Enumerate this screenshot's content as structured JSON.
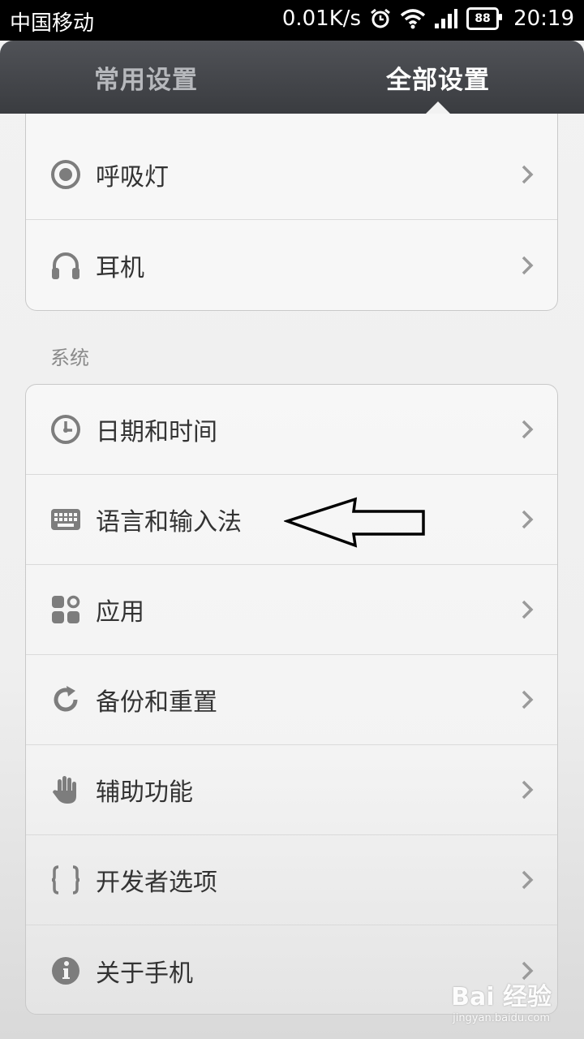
{
  "status_bar": {
    "carrier": "中国移动",
    "speed": "0.01K/s",
    "battery": "88",
    "time": "20:19"
  },
  "tabs": [
    {
      "label": "常用设置",
      "active": false
    },
    {
      "label": "全部设置",
      "active": true
    }
  ],
  "top_group": {
    "items": [
      {
        "label": "呼吸灯",
        "icon": "breathing-light-icon"
      },
      {
        "label": "耳机",
        "icon": "headphones-icon"
      }
    ]
  },
  "system_section": {
    "title": "系统",
    "items": [
      {
        "label": "日期和时间",
        "icon": "clock-icon"
      },
      {
        "label": "语言和输入法",
        "icon": "keyboard-icon"
      },
      {
        "label": "应用",
        "icon": "apps-icon"
      },
      {
        "label": "备份和重置",
        "icon": "refresh-icon"
      },
      {
        "label": "辅助功能",
        "icon": "hand-icon"
      },
      {
        "label": "开发者选项",
        "icon": "braces-icon"
      },
      {
        "label": "关于手机",
        "icon": "info-icon"
      }
    ]
  },
  "watermark": {
    "logo": "Bai 经验",
    "url": "jingyan.baidu.com"
  },
  "colors": {
    "icon_gray": "#7d7d7d",
    "chevron_gray": "#9a9a9a",
    "tab_active": "#ffffff",
    "tab_inactive": "#b6b8bc"
  }
}
